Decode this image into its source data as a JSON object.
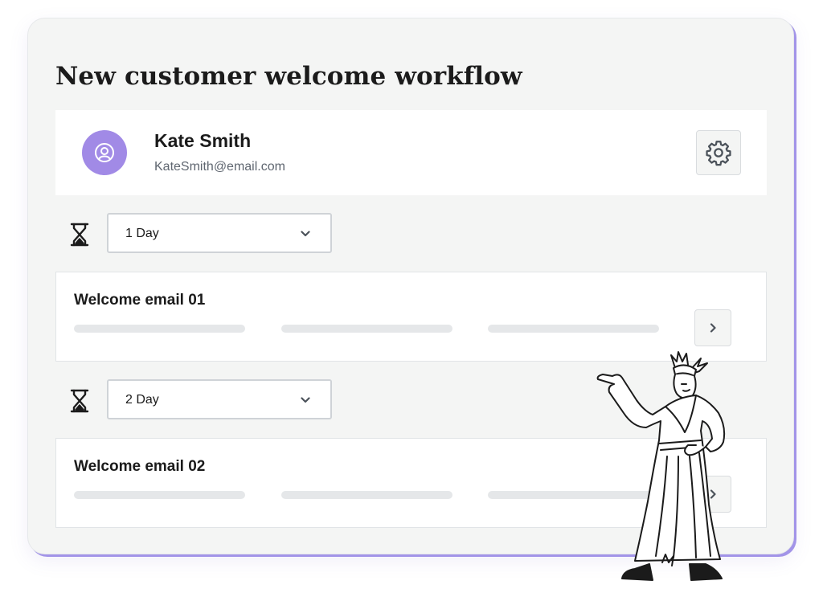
{
  "workflow": {
    "title": "New customer welcome workflow"
  },
  "contact": {
    "name": "Kate Smith",
    "email": "KateSmith@email.com",
    "avatar_icon": "user-circle-icon",
    "settings_icon": "gear-icon"
  },
  "steps": [
    {
      "delay": "1 Day",
      "email_title": "Welcome email 01"
    },
    {
      "delay": "2 Day",
      "email_title": "Welcome email 02"
    }
  ],
  "icons": {
    "delay": "hourglass-icon",
    "dropdown": "chevron-down-icon",
    "open": "chevron-right-icon"
  },
  "colors": {
    "accent": "#a18ae6",
    "card_shadow": "#a294e8",
    "background": "#f4f5f4"
  }
}
